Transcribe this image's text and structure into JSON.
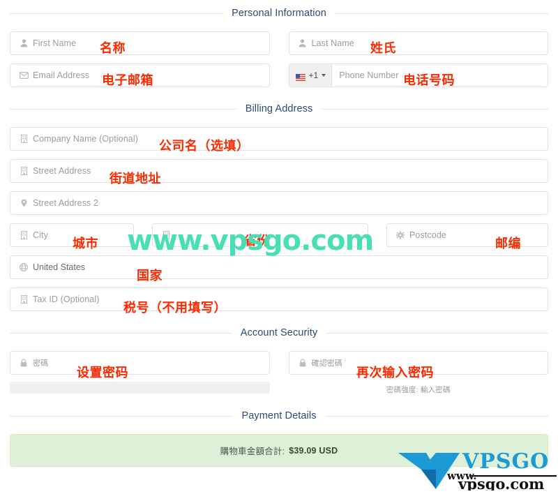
{
  "sections": {
    "personal": "Personal Information",
    "billing": "Billing Address",
    "security": "Account Security",
    "payment": "Payment Details"
  },
  "fields": {
    "first_name": {
      "placeholder": "First Name",
      "icon": "person-icon",
      "annotation": "名称"
    },
    "last_name": {
      "placeholder": "Last Name",
      "icon": "person-icon",
      "annotation": "姓氏"
    },
    "email": {
      "placeholder": "Email Address",
      "icon": "envelope-icon",
      "annotation": "电子邮箱"
    },
    "phone": {
      "placeholder": "Phone Number",
      "dial_code": "+1",
      "flag": "us-flag-icon",
      "annotation": "电话号码"
    },
    "company": {
      "placeholder": "Company Name (Optional)",
      "icon": "building-icon",
      "annotation": "公司名（选填）"
    },
    "street1": {
      "placeholder": "Street Address",
      "icon": "building-icon",
      "annotation": "街道地址"
    },
    "street2": {
      "placeholder": "Street Address 2",
      "icon": "map-pin-icon",
      "annotation": ""
    },
    "city": {
      "placeholder": "City",
      "icon": "building-icon",
      "annotation": "城市"
    },
    "state": {
      "placeholder": "",
      "icon": "building-icon",
      "annotation": "省份"
    },
    "postcode": {
      "placeholder": "Postcode",
      "icon": "gear-icon",
      "annotation": "邮编"
    },
    "country": {
      "value": "United States",
      "icon": "globe-icon",
      "annotation": "国家"
    },
    "tax_id": {
      "placeholder": "Tax ID (Optional)",
      "icon": "building-icon",
      "annotation": "税号（不用填写）"
    },
    "password": {
      "placeholder": "密碼",
      "icon": "lock-icon",
      "annotation": "设置密码"
    },
    "confirm_password": {
      "placeholder": "確認密碼",
      "icon": "lock-icon",
      "annotation": "再次输入密码"
    }
  },
  "password_strength": {
    "hint": "密碼強度: 輸入密碼",
    "progress": 0
  },
  "payment": {
    "label": "購物車金額合計:",
    "amount": "$39.09 USD"
  },
  "watermark": {
    "text": "www.vpsgo.com",
    "color": "#49dfb4",
    "logo_name": "VPSGO",
    "logo_www": "www.",
    "logo_domain": "vpsgo.com"
  },
  "colors": {
    "heading": "#2a4b73",
    "annotation": "#fc2a00",
    "alert_bg": "#dff0d8",
    "logo_blue": "#1b9ad6",
    "logo_dark": "#0f7fc0"
  }
}
